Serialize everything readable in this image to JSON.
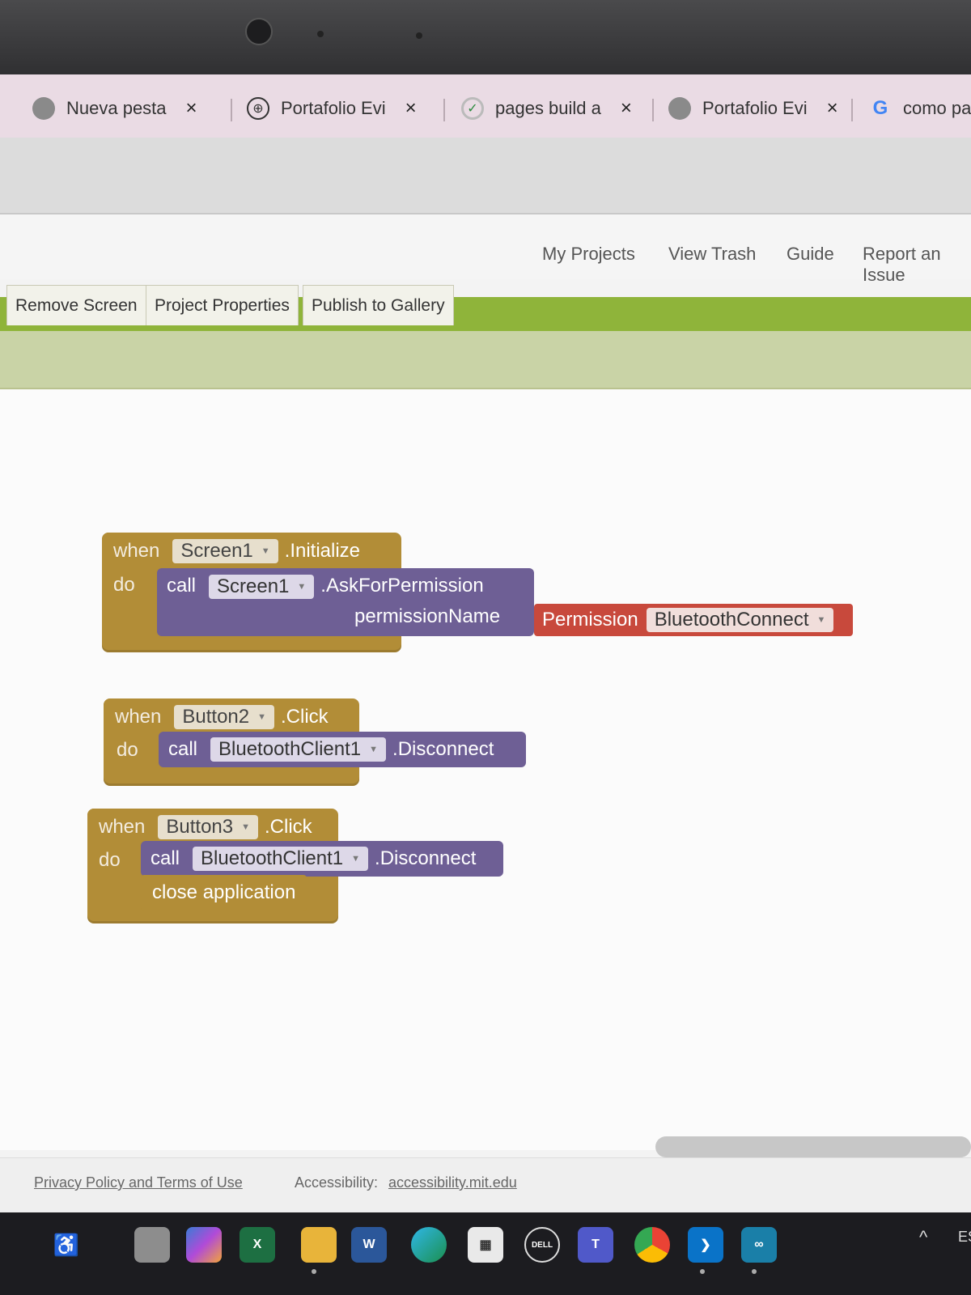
{
  "browser": {
    "tabs": [
      {
        "icon": "globe-gray-icon",
        "title": "Nueva pesta",
        "close": "×"
      },
      {
        "icon": "globe-outline-icon",
        "title": "Portafolio Evi",
        "close": "×"
      },
      {
        "icon": "loading-check-icon",
        "title": "pages build a",
        "close": "×"
      },
      {
        "icon": "globe-gray-icon",
        "title": "Portafolio Evi",
        "close": "×"
      },
      {
        "icon": "google-icon",
        "title": "como pas"
      }
    ]
  },
  "app_header": {
    "links": [
      "My Projects",
      "View Trash",
      "Guide",
      "Report an Issue"
    ]
  },
  "toolbar": {
    "remove_screen": "Remove Screen",
    "project_properties": "Project Properties",
    "publish_to_gallery": "Publish to Gallery"
  },
  "blocks": {
    "b1": {
      "when": "when",
      "component": "Screen1",
      "event": ".Initialize",
      "do": "do",
      "call": "call",
      "call_component": "Screen1",
      "method": ".AskForPermission",
      "param": "permissionName",
      "perm_label": "Permission",
      "perm_value": "BluetoothConnect"
    },
    "b2": {
      "when": "when",
      "component": "Button2",
      "event": ".Click",
      "do": "do",
      "call": "call",
      "call_component": "BluetoothClient1",
      "method": ".Disconnect"
    },
    "b3": {
      "when": "when",
      "component": "Button3",
      "event": ".Click",
      "do": "do",
      "call": "call",
      "call_component": "BluetoothClient1",
      "method": ".Disconnect",
      "close": "close application"
    }
  },
  "footer": {
    "privacy": "Privacy Policy and Terms of Use",
    "accessibility_label": "Accessibility:",
    "accessibility_link": "accessibility.mit.edu"
  },
  "taskbar": {
    "language": "ES",
    "apps": [
      "accessibility-icon",
      "files-icon",
      "copilot-icon",
      "excel-icon",
      "file-explorer-icon",
      "word-icon",
      "edge-icon",
      "store-icon",
      "dell-icon",
      "teams-icon",
      "chrome-icon",
      "vscode-icon",
      "app-infinity-icon"
    ]
  }
}
